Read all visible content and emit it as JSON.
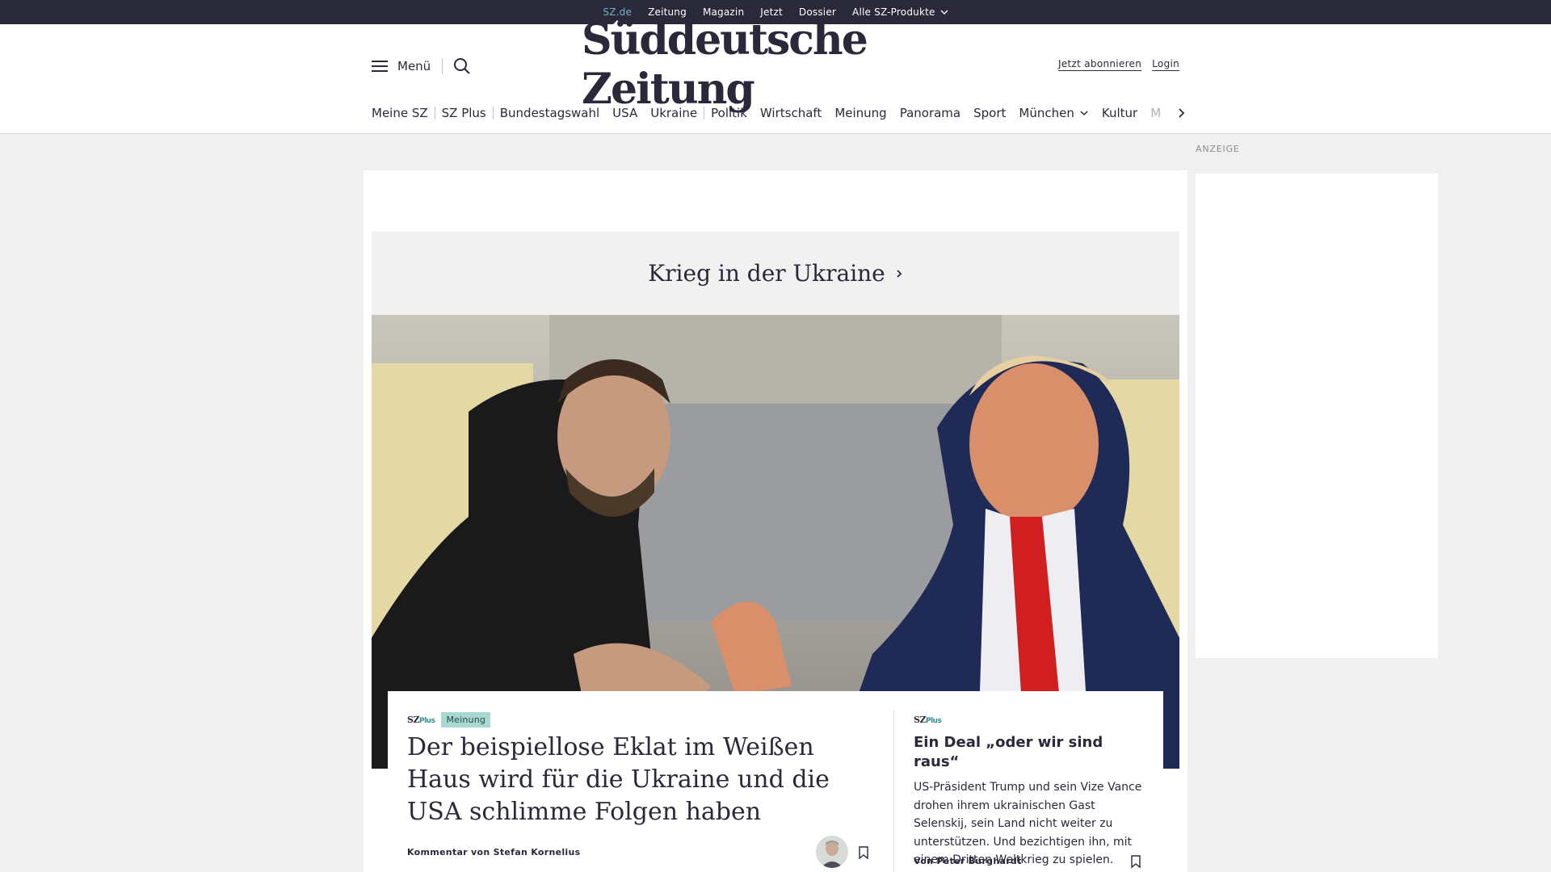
{
  "topbar": {
    "items": [
      "SZ.de",
      "Zeitung",
      "Magazin",
      "Jetzt",
      "Dossier",
      "Alle SZ-Produkte"
    ]
  },
  "header": {
    "menu_label": "Menü",
    "logo": "Süddeutsche Zeitung",
    "subscribe": "Jetzt abonnieren",
    "login": "Login"
  },
  "nav": {
    "items": [
      "Meine SZ",
      "SZ Plus",
      "Bundestagswahl",
      "USA",
      "Ukraine",
      "Politik",
      "Wirtschaft",
      "Meinung",
      "Panorama",
      "Sport",
      "München",
      "Kultur",
      "M"
    ]
  },
  "ad": {
    "label": "ANZEIGE"
  },
  "dossier": {
    "title": "Krieg in der Ukraine"
  },
  "lead": {
    "plus_brand": "SZ",
    "plus_suffix": "Plus",
    "tag": "Meinung",
    "headline": "Der beispiellose Eklat im Weißen Haus wird für die Ukraine und die USA schlimme Folgen haben",
    "byline": "Kommentar von Stefan Kornelius"
  },
  "side": {
    "plus_brand": "SZ",
    "plus_suffix": "Plus",
    "title": "Ein Deal „oder wir sind raus“",
    "text": "US-Präsident Trump und sein Vize Vance drohen ihrem ukrainischen Gast Selenskij, sein Land nicht weiter zu unterstützen. Und bezichtigen ihn, mit einem Dritten Weltkrieg zu spielen.",
    "byline": "Von Peter Burghardt"
  },
  "colors": {
    "dark": "#29293a",
    "accent_teal": "#71b1c9",
    "tag_bg": "#a8d8d0"
  }
}
